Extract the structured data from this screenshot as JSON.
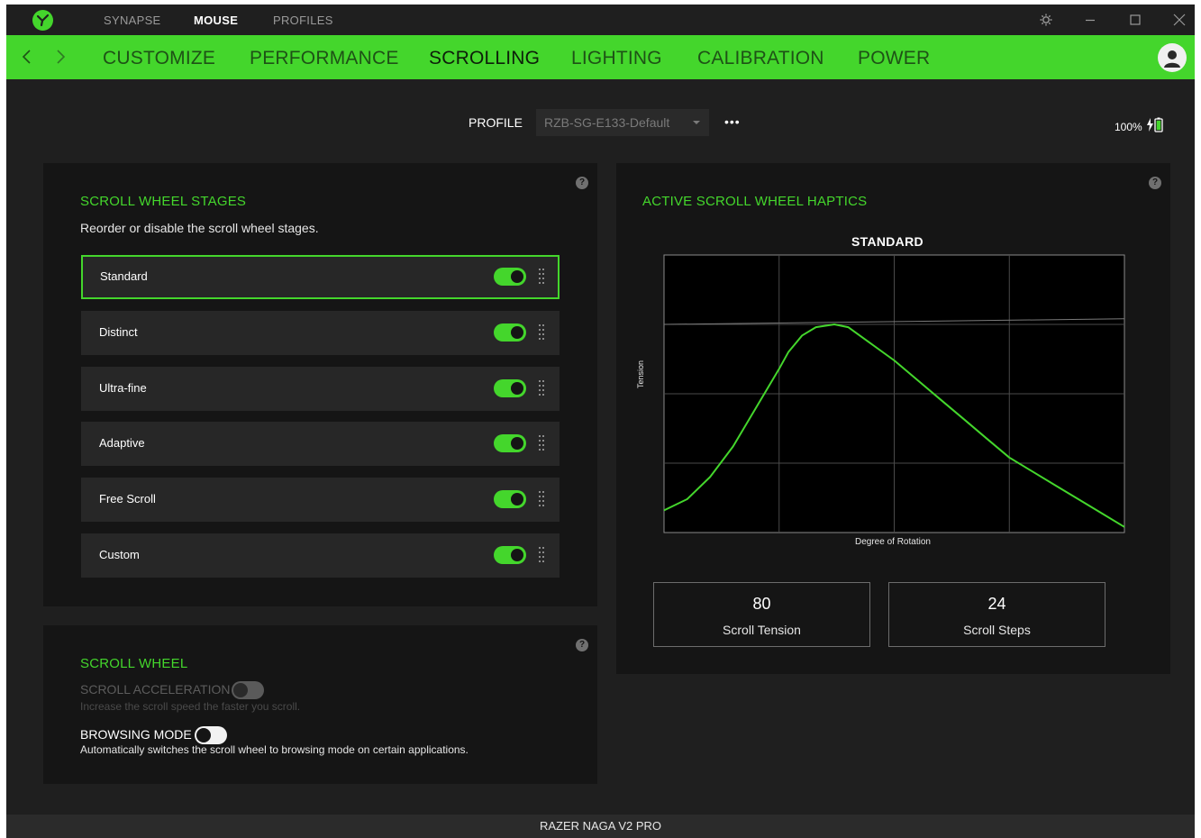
{
  "titlebar": {
    "tabs": [
      {
        "label": "SYNAPSE",
        "active": false
      },
      {
        "label": "MOUSE",
        "active": true
      },
      {
        "label": "PROFILES",
        "active": false
      }
    ]
  },
  "nav": {
    "tabs": [
      {
        "label": "CUSTOMIZE",
        "active": false
      },
      {
        "label": "PERFORMANCE",
        "active": false
      },
      {
        "label": "SCROLLING",
        "active": true
      },
      {
        "label": "LIGHTING",
        "active": false
      },
      {
        "label": "CALIBRATION",
        "active": false
      },
      {
        "label": "POWER",
        "active": false
      }
    ]
  },
  "profile": {
    "label": "PROFILE",
    "value": "RZB-SG-E133-Default",
    "more": "•••"
  },
  "battery": {
    "level": "100%",
    "charging": true
  },
  "stages_panel": {
    "title": "SCROLL WHEEL STAGES",
    "subtitle": "Reorder or disable the scroll wheel stages.",
    "help": "?",
    "stages": [
      {
        "name": "Standard",
        "enabled": true,
        "selected": true
      },
      {
        "name": "Distinct",
        "enabled": true,
        "selected": false
      },
      {
        "name": "Ultra-fine",
        "enabled": true,
        "selected": false
      },
      {
        "name": "Adaptive",
        "enabled": true,
        "selected": false
      },
      {
        "name": "Free Scroll",
        "enabled": true,
        "selected": false
      },
      {
        "name": "Custom",
        "enabled": true,
        "selected": false
      }
    ]
  },
  "wheel_panel": {
    "title": "SCROLL WHEEL",
    "help": "?",
    "acceleration": {
      "label": "SCROLL ACCELERATION",
      "description": "Increase the scroll speed the faster you scroll.",
      "enabled": false,
      "disabled": true
    },
    "browsing": {
      "label": "BROWSING MODE",
      "description": "Automatically switches the scroll wheel to browsing mode on certain applications.",
      "enabled": false
    }
  },
  "haptics_panel": {
    "title": "ACTIVE SCROLL WHEEL HAPTICS",
    "help": "?",
    "chart_title": "STANDARD",
    "y_label": "Tension",
    "x_label": "Degree of Rotation",
    "tension": {
      "value": "80",
      "label": "Scroll Tension"
    },
    "steps": {
      "value": "24",
      "label": "Scroll Steps"
    }
  },
  "chart_data": {
    "type": "line",
    "title": "STANDARD",
    "xlabel": "Degree of Rotation",
    "ylabel": "Tension",
    "grid": true,
    "xlim": [
      0,
      100
    ],
    "ylim": [
      0,
      100
    ],
    "series": [
      {
        "color": "#44d62c",
        "x": [
          0,
          5,
          10,
          15,
          20,
          25,
          27,
          30,
          33,
          37,
          40,
          45,
          50,
          55,
          60,
          65,
          70,
          75,
          80,
          85,
          90,
          95,
          100
        ],
        "y": [
          8,
          12,
          20,
          31,
          45,
          59,
          65,
          71,
          74,
          75,
          74,
          68,
          62,
          55,
          48,
          41,
          34,
          27,
          22,
          17,
          12,
          7,
          2
        ]
      },
      {
        "color": "#7a7a7a",
        "x": [
          0,
          100
        ],
        "y": [
          75,
          77
        ]
      }
    ]
  },
  "footer": {
    "device": "RAZER NAGA V2 PRO"
  },
  "colors": {
    "accent": "#44d62c",
    "background": "#1f1f1f",
    "panel": "#151515",
    "row": "#272727"
  }
}
